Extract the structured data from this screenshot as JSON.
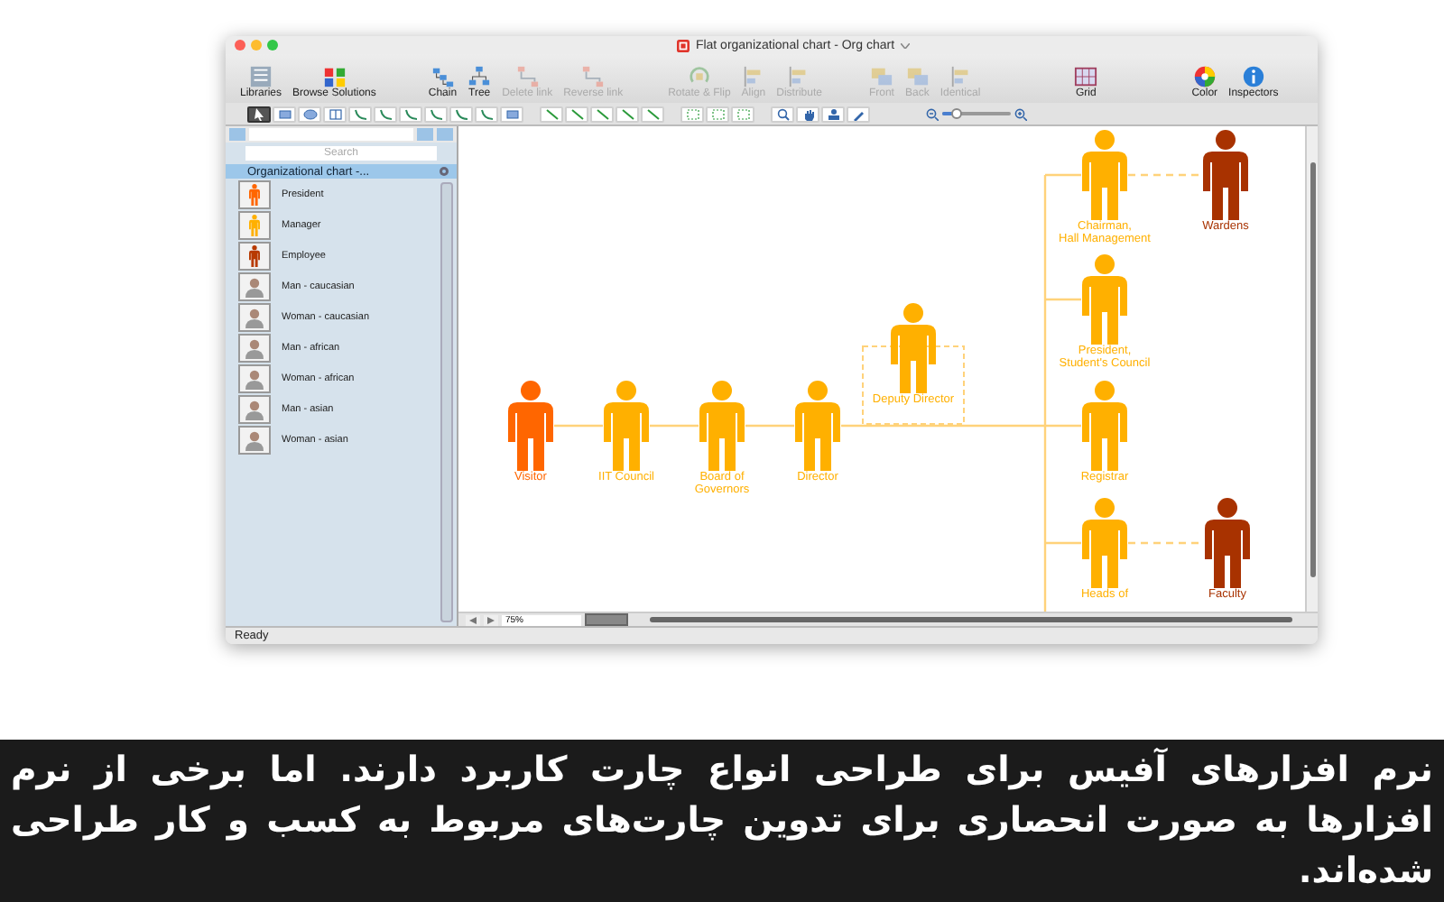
{
  "window": {
    "title": "Flat organizational chart - Org chart"
  },
  "toolbar": [
    {
      "label": "Libraries",
      "kind": "libraries",
      "disabled": false
    },
    {
      "label": "Browse Solutions",
      "kind": "solutions",
      "disabled": false
    },
    {
      "label": "Chain",
      "kind": "chain",
      "disabled": false
    },
    {
      "label": "Tree",
      "kind": "tree",
      "disabled": false
    },
    {
      "label": "Delete link",
      "kind": "link",
      "disabled": true
    },
    {
      "label": "Reverse link",
      "kind": "link",
      "disabled": true
    },
    {
      "label": "Rotate & Flip",
      "kind": "rotate",
      "disabled": true
    },
    {
      "label": "Align",
      "kind": "align",
      "disabled": true
    },
    {
      "label": "Distribute",
      "kind": "align",
      "disabled": true
    },
    {
      "label": "Front",
      "kind": "stack",
      "disabled": true
    },
    {
      "label": "Back",
      "kind": "stack",
      "disabled": true
    },
    {
      "label": "Identical",
      "kind": "align",
      "disabled": true
    },
    {
      "label": "Grid",
      "kind": "grid",
      "disabled": false
    },
    {
      "label": "Color",
      "kind": "color",
      "disabled": false
    },
    {
      "label": "Inspectors",
      "kind": "info",
      "disabled": false
    }
  ],
  "tool_groups": [
    [
      {
        "kind": "pointer",
        "selected": true
      },
      {
        "kind": "rect",
        "selected": false
      },
      {
        "kind": "ellipse",
        "selected": false
      },
      {
        "kind": "table",
        "selected": false
      },
      {
        "kind": "connector",
        "selected": false
      },
      {
        "kind": "connector",
        "selected": false
      },
      {
        "kind": "connector",
        "selected": false
      },
      {
        "kind": "connector",
        "selected": false
      },
      {
        "kind": "connector",
        "selected": false
      },
      {
        "kind": "connector",
        "selected": false
      },
      {
        "kind": "rect",
        "selected": false
      }
    ],
    [
      {
        "kind": "line",
        "selected": false
      },
      {
        "kind": "line",
        "selected": false
      },
      {
        "kind": "line",
        "selected": false
      },
      {
        "kind": "line",
        "selected": false
      },
      {
        "kind": "line",
        "selected": false
      }
    ],
    [
      {
        "kind": "frame",
        "selected": false
      },
      {
        "kind": "frame",
        "selected": false
      },
      {
        "kind": "frame",
        "selected": false
      }
    ],
    [
      {
        "kind": "zoom",
        "selected": false
      },
      {
        "kind": "hand",
        "selected": false
      },
      {
        "kind": "stamp",
        "selected": false
      },
      {
        "kind": "dropper",
        "selected": false
      }
    ]
  ],
  "zoom_slider": {
    "level": 0.2
  },
  "library": {
    "search": {
      "placeholder": "Search"
    },
    "title": "Organizational chart -...",
    "items": [
      {
        "label": "President",
        "kind": "figure",
        "color": "#ff6600"
      },
      {
        "label": "Manager",
        "kind": "figure",
        "color": "#ffb000"
      },
      {
        "label": "Employee",
        "kind": "figure",
        "color": "#b83a00"
      },
      {
        "label": "Man - caucasian",
        "kind": "avatar"
      },
      {
        "label": "Woman - caucasian",
        "kind": "avatar"
      },
      {
        "label": "Man - african",
        "kind": "avatar"
      },
      {
        "label": "Woman - african",
        "kind": "avatar"
      },
      {
        "label": "Man - asian",
        "kind": "avatar"
      },
      {
        "label": "Woman - asian",
        "kind": "avatar"
      }
    ]
  },
  "chart": {
    "root": {
      "label": "Visitor",
      "color": "#ff6600",
      "children": [
        {
          "label": "IIT Council",
          "color": "#ffb000",
          "kind": "line",
          "children": [
            {
              "label": "Board of\nGovernors",
              "color": "#ffb000",
              "kind": "line",
              "children": [
                {
                  "label": "Director",
                  "color": "#ffb000",
                  "kind": "line",
                  "children": [
                    {
                      "label": "Deputy Director",
                      "color": "#ffb000",
                      "kind": "frame",
                      "children": [
                        {
                          "label": "Chairman,\nHall Management",
                          "color": "#ffb000",
                          "kind": "trunk",
                          "children": [
                            {
                              "label": "Wardens",
                              "color": "#a83200",
                              "kind": "dashed"
                            }
                          ]
                        },
                        {
                          "label": "President,\nStudent's Council",
                          "color": "#ffb000",
                          "kind": "trunk"
                        },
                        {
                          "label": "Registrar",
                          "color": "#ffb000",
                          "kind": "trunk"
                        },
                        {
                          "label": "Heads of",
                          "color": "#ffb000",
                          "kind": "trunk",
                          "children": [
                            {
                              "label": "Faculty",
                              "color": "#a83200",
                              "kind": "dashed"
                            }
                          ]
                        }
                      ]
                    }
                  ]
                }
              ]
            }
          ]
        }
      ]
    }
  },
  "canvas_footer": {
    "zoom": "75%"
  },
  "status_bar": {
    "text": "Ready"
  },
  "caption": "نرم افزارهای آفیس برای طراحی انواع چارت کاربرد دارند. اما برخی از نرم افزارها به صورت انحصاری برای تدوین چارت‌های مربوط به کسب و کار طراحی شده‌اند."
}
